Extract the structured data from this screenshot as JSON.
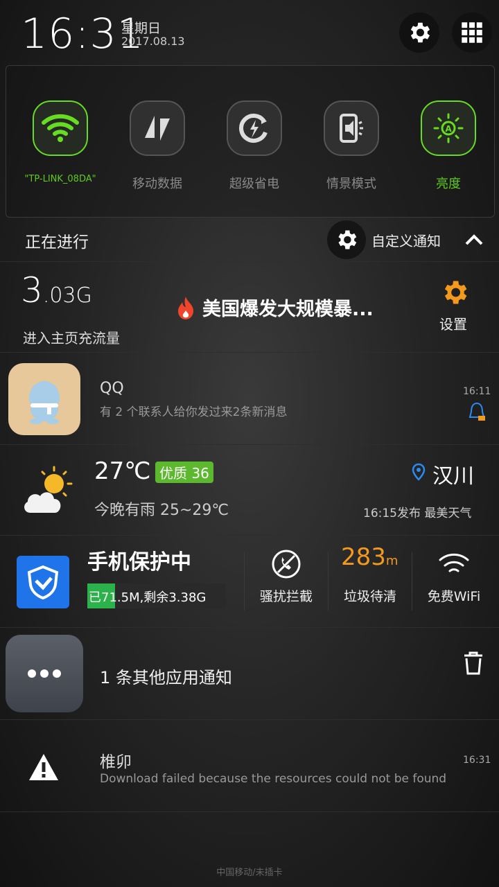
{
  "status": {
    "time": "16:31",
    "weekday": "星期日",
    "date": "2017.08.13"
  },
  "toggles": [
    {
      "label": "\"TP-LINK_08DA\"",
      "icon": "wifi-icon",
      "active": true
    },
    {
      "label": "移动数据",
      "icon": "mobile-data-icon",
      "active": false
    },
    {
      "label": "超级省电",
      "icon": "power-saving-icon",
      "active": false
    },
    {
      "label": "情景模式",
      "icon": "sound-profile-icon",
      "active": false
    },
    {
      "label": "亮度",
      "icon": "brightness-auto-icon",
      "active": true
    }
  ],
  "ongoing": {
    "title": "正在进行",
    "custom_label": "自定义通知"
  },
  "data_widget": {
    "amount": "3.03G",
    "amount_main": "3",
    "amount_rest": ".03G",
    "subtitle": "进入主页充流量",
    "news": "美国爆发大规模暴...",
    "settings_label": "设置"
  },
  "qq": {
    "title": "QQ",
    "message": "有 2 个联系人给你发过来2条新消息",
    "time": "16:11"
  },
  "weather": {
    "temp": "27℃",
    "aqi": "优质 36",
    "forecast": "今晚有雨  25~29℃",
    "city": "汉川",
    "published": "16:15发布 最美天气"
  },
  "security": {
    "title": "手机保护中",
    "usage": "已71.5M,剩余3.38G",
    "usage_fraction": 0.2,
    "block_label": "骚扰拦截",
    "junk_value": "283",
    "junk_unit": "m",
    "junk_label": "垃圾待清",
    "wifi_label": "免费WiFi"
  },
  "other": {
    "text": "1 条其他应用通知"
  },
  "download": {
    "title": "椎卯",
    "message": "Download failed because the resources could not be found",
    "time": "16:31"
  },
  "carrier": "中国移动/未插卡",
  "colors": {
    "accent_green": "#66dd22",
    "orange": "#f39a1e",
    "tencent_blue": "#1e74e8",
    "location_blue": "#2a8cf0"
  }
}
